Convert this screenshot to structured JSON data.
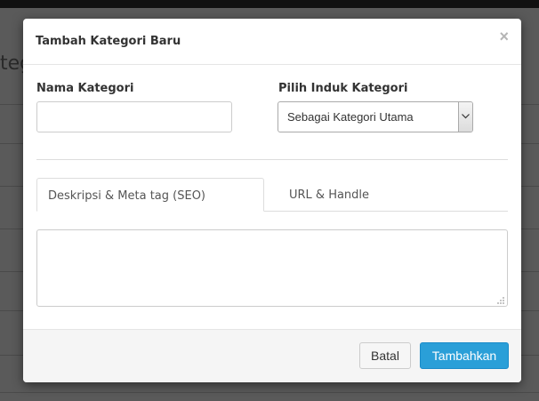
{
  "background": {
    "heading_fragment": "teg"
  },
  "modal": {
    "title": "Tambah Kategori Baru",
    "close_glyph": "×",
    "name_field": {
      "label": "Nama Kategori",
      "value": ""
    },
    "parent_select": {
      "label": "Pilih Induk Kategori",
      "selected": "Sebagai Kategori Utama"
    },
    "tabs": [
      {
        "label": "Deskripsi & Meta tag (SEO)",
        "active": true
      },
      {
        "label": "URL & Handle",
        "active": false
      }
    ],
    "description_value": "",
    "footer": {
      "cancel_label": "Batal",
      "submit_label": "Tambahkan"
    }
  },
  "colors": {
    "primary": "#2a9fd8",
    "overlay": "#5a5a5a"
  },
  "icons": {
    "close": "close-icon",
    "select_arrow": "chevron-down-icon",
    "resize": "resize-handle-icon"
  }
}
